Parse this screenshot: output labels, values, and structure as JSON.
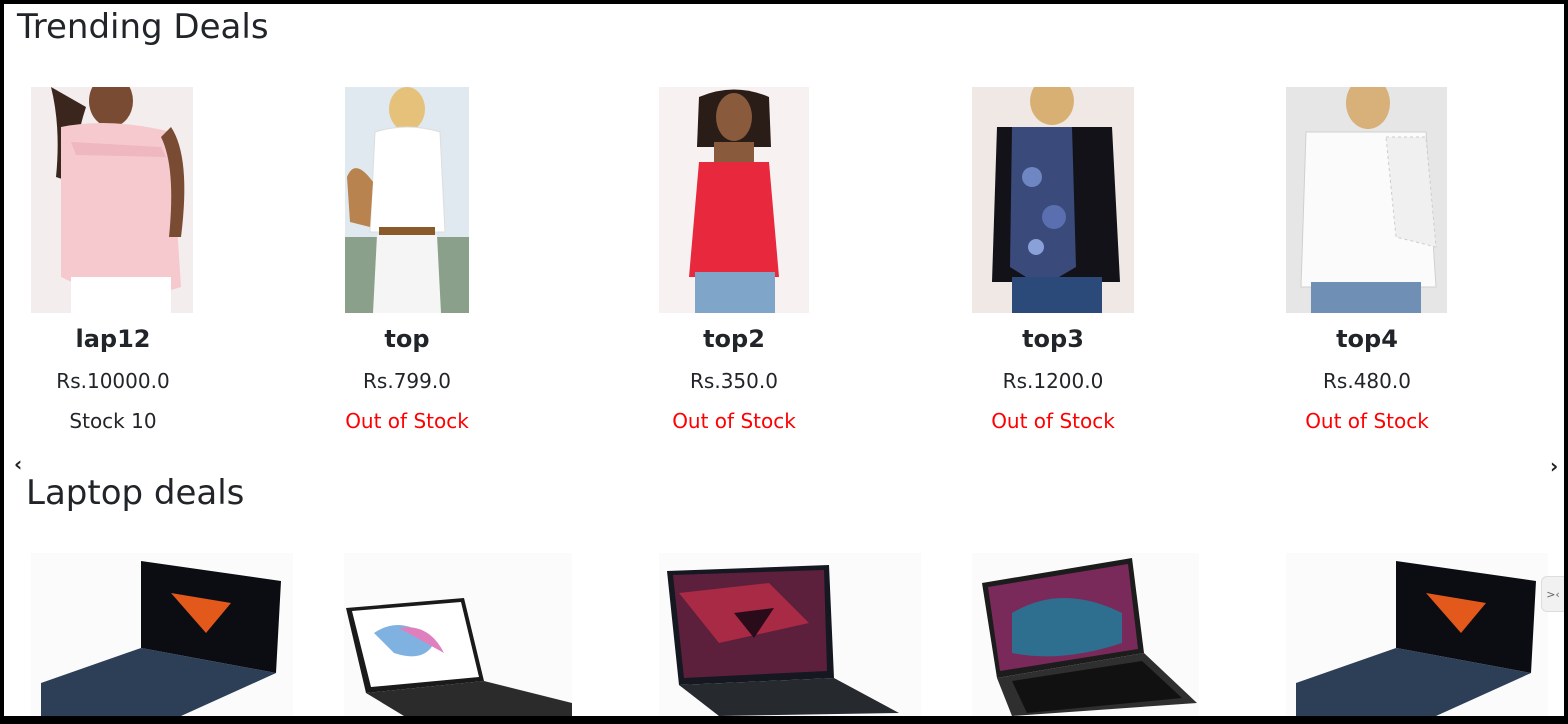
{
  "trending": {
    "title": "Trending Deals",
    "items": [
      {
        "name": "lap12",
        "price": "Rs.10000.0",
        "stock": "Stock 10",
        "in_stock": true
      },
      {
        "name": "top",
        "price": "Rs.799.0",
        "stock": "Out of Stock",
        "in_stock": false
      },
      {
        "name": "top2",
        "price": "Rs.350.0",
        "stock": "Out of Stock",
        "in_stock": false
      },
      {
        "name": "top3",
        "price": "Rs.1200.0",
        "stock": "Out of Stock",
        "in_stock": false
      },
      {
        "name": "top4",
        "price": "Rs.480.0",
        "stock": "Out of Stock",
        "in_stock": false
      }
    ]
  },
  "laptops": {
    "title": "Laptop deals"
  },
  "carousel": {
    "prev": "‹",
    "next": "›"
  },
  "side_tab": {
    "label": ">‹"
  },
  "colors": {
    "text": "#212529",
    "out_of_stock": "#ff0000",
    "in_stock": "#212529"
  }
}
